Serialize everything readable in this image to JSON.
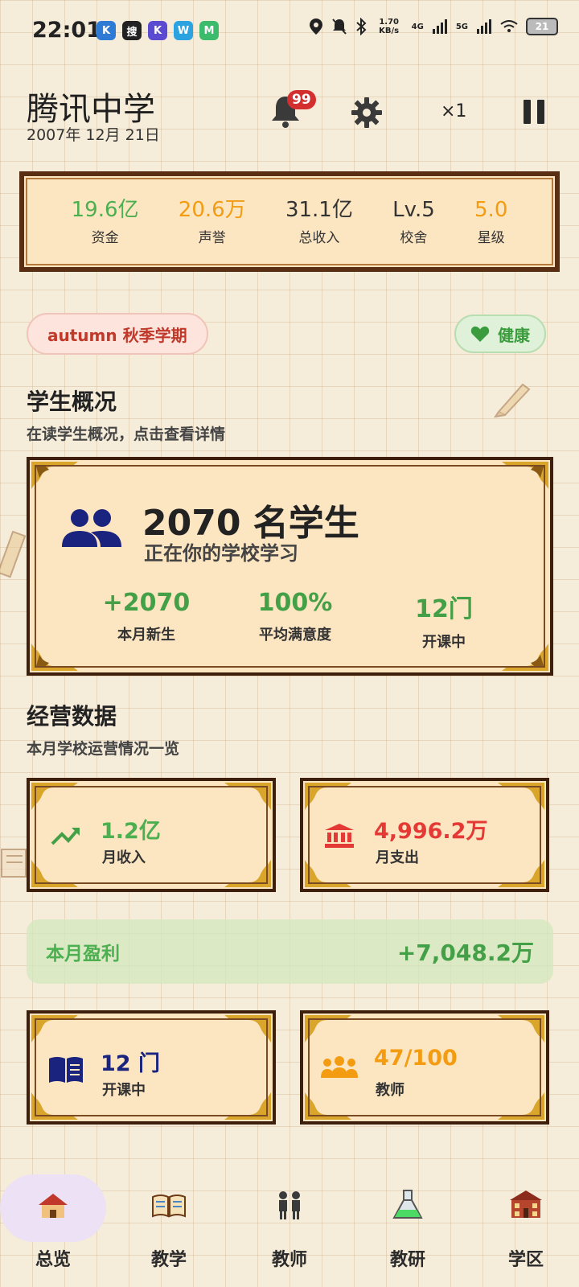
{
  "status_bar": {
    "time": "22:01",
    "net_speed": "1.70 KB/s",
    "net_4g": "4G",
    "net_5g": "5G",
    "battery": "21",
    "app_icons": [
      "K",
      "搜",
      "K",
      "W",
      "M"
    ]
  },
  "header": {
    "school_name": "腾讯中学",
    "date": "2007年 12月 21日",
    "notification_count": "99",
    "speed": "×1"
  },
  "stats": [
    {
      "value": "19.6亿",
      "label": "资金",
      "color": "#4caf50"
    },
    {
      "value": "20.6万",
      "label": "声誉",
      "color": "#f39c12"
    },
    {
      "value": "31.1亿",
      "label": "总收入",
      "color": "#333333"
    },
    {
      "value": "Lv.5",
      "label": "校舍",
      "color": "#333333"
    },
    {
      "value": "5.0",
      "label": "星级",
      "color": "#f39c12"
    }
  ],
  "term": {
    "label": "autumn 秋季学期"
  },
  "health": {
    "label": "健康"
  },
  "students_section": {
    "title": "学生概况",
    "subtitle": "在读学生概况，点击查看详情",
    "count": "2070 名学生",
    "count_sub": "正在你的学校学习",
    "metrics": [
      {
        "value": "+2070",
        "label": "本月新生"
      },
      {
        "value": "100%",
        "label": "平均满意度"
      },
      {
        "value": "12门",
        "label": "开课中"
      }
    ]
  },
  "ops_section": {
    "title": "经营数据",
    "subtitle": "本月学校运营情况一览",
    "income": {
      "value": "1.2亿",
      "label": "月收入",
      "color": "#4caf50"
    },
    "expense": {
      "value": "4,996.2万",
      "label": "月支出",
      "color": "#e53935"
    },
    "profit": {
      "label": "本月盈利",
      "value": "+7,048.2万"
    },
    "courses": {
      "value": "12 门",
      "label": "开课中",
      "color": "#1a237e"
    },
    "teachers": {
      "value": "47/100",
      "label": "教师",
      "color": "#f39c12"
    }
  },
  "nav": [
    {
      "label": "总览",
      "icon": "school-house-icon",
      "active": true
    },
    {
      "label": "教学",
      "icon": "open-book-icon",
      "active": false
    },
    {
      "label": "教师",
      "icon": "teachers-icon",
      "active": false
    },
    {
      "label": "教研",
      "icon": "flask-icon",
      "active": false
    },
    {
      "label": "学区",
      "icon": "campus-icon",
      "active": false
    }
  ],
  "colors": {
    "panel_bg": "#fce5c1",
    "frame_border": "#3e1f0b",
    "accent_green": "#43a047",
    "accent_orange": "#f39c12",
    "accent_red": "#e53935",
    "accent_navy": "#1a237e"
  }
}
